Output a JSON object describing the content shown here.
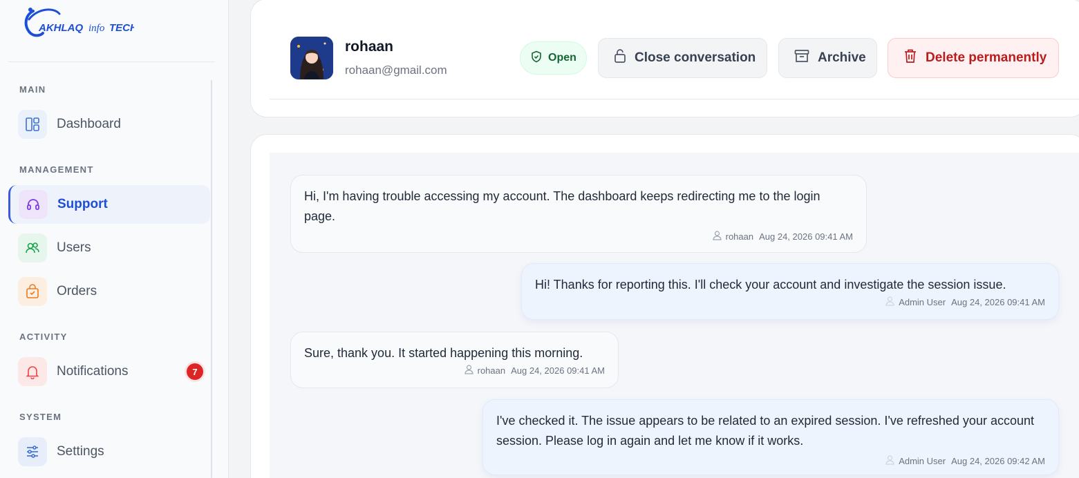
{
  "brand": {
    "logo_text": "AKHLAQ infoTECH"
  },
  "sidebar": {
    "sections": [
      {
        "label": "MAIN"
      },
      {
        "label": "MANAGEMENT"
      },
      {
        "label": "ACTIVITY"
      },
      {
        "label": "SYSTEM"
      }
    ],
    "items": [
      {
        "label": "Dashboard",
        "icon": "layout-icon"
      },
      {
        "label": "Support",
        "icon": "headset-icon",
        "active": true
      },
      {
        "label": "Users",
        "icon": "users-icon"
      },
      {
        "label": "Orders",
        "icon": "shopping-bag-icon"
      },
      {
        "label": "Notifications",
        "icon": "bell-icon",
        "badge": "7"
      },
      {
        "label": "Settings",
        "icon": "sliders-icon"
      }
    ]
  },
  "conversation": {
    "user_name": "rohaan",
    "user_email": "rohaan@gmail.com",
    "status": "Open",
    "actions": {
      "close": "Close conversation",
      "archive": "Archive",
      "delete": "Delete permanently"
    }
  },
  "messages": [
    {
      "sender": "rohaan",
      "role": "user",
      "text": "Hi, I'm having trouble accessing my account. The dashboard keeps redirecting me to the login page.",
      "time": "Aug 24, 2026 09:41 AM"
    },
    {
      "sender": "Admin User",
      "role": "admin",
      "text": "Hi! Thanks for reporting this. I'll check your account and investigate the session issue.",
      "time": "Aug 24, 2026 09:41 AM"
    },
    {
      "sender": "rohaan",
      "role": "user",
      "text": "Sure, thank you. It started happening this morning.",
      "time": "Aug 24, 2026 09:41 AM"
    },
    {
      "sender": "Admin User",
      "role": "admin",
      "text": "I've checked it. The issue appears to be related to an expired session. I've refreshed your account session. Please log in again and let me know if it works.",
      "time": "Aug 24, 2026 09:42 AM"
    }
  ],
  "colors": {
    "accent": "#1d4ed8",
    "danger": "#b91c1c",
    "success": "#166534"
  }
}
